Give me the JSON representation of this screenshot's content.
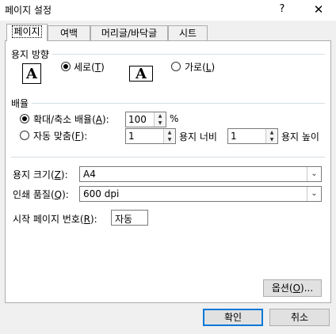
{
  "window": {
    "title": "페이지 설정",
    "help": "?",
    "close": "✕"
  },
  "tabs": [
    {
      "label": "페이지"
    },
    {
      "label": "여백"
    },
    {
      "label": "머리글/바닥글"
    },
    {
      "label": "시트"
    }
  ],
  "orientation": {
    "title": "용지 방향",
    "portrait": {
      "label": "세로(",
      "key": "T",
      "suffix": ")",
      "icon_letter": "A"
    },
    "landscape": {
      "label": "가로(",
      "key": "L",
      "suffix": ")",
      "icon_letter": "A"
    }
  },
  "scaling": {
    "title": "배율",
    "adjust": {
      "label": "확대/축소 배율(",
      "key": "A",
      "suffix": "):",
      "value": "100",
      "unit": "%"
    },
    "fit": {
      "label": "자동 맞춤(",
      "key": "F",
      "suffix": "):",
      "wide_value": "1",
      "wide_label": "용지 너비",
      "tall_value": "1",
      "tall_label": "용지 높이"
    }
  },
  "paper_size": {
    "label": "용지 크기(",
    "key": "Z",
    "suffix": "):",
    "value": "A4"
  },
  "print_quality": {
    "label": "인쇄 품질(",
    "key": "Q",
    "suffix": "):",
    "value": "600 dpi"
  },
  "first_page": {
    "label": "시작 페이지 번호(",
    "key": "R",
    "suffix": "):",
    "value": "자동"
  },
  "buttons": {
    "options": {
      "label": "옵션(",
      "key": "O",
      "suffix": ")..."
    },
    "ok": "확인",
    "cancel": "취소"
  }
}
